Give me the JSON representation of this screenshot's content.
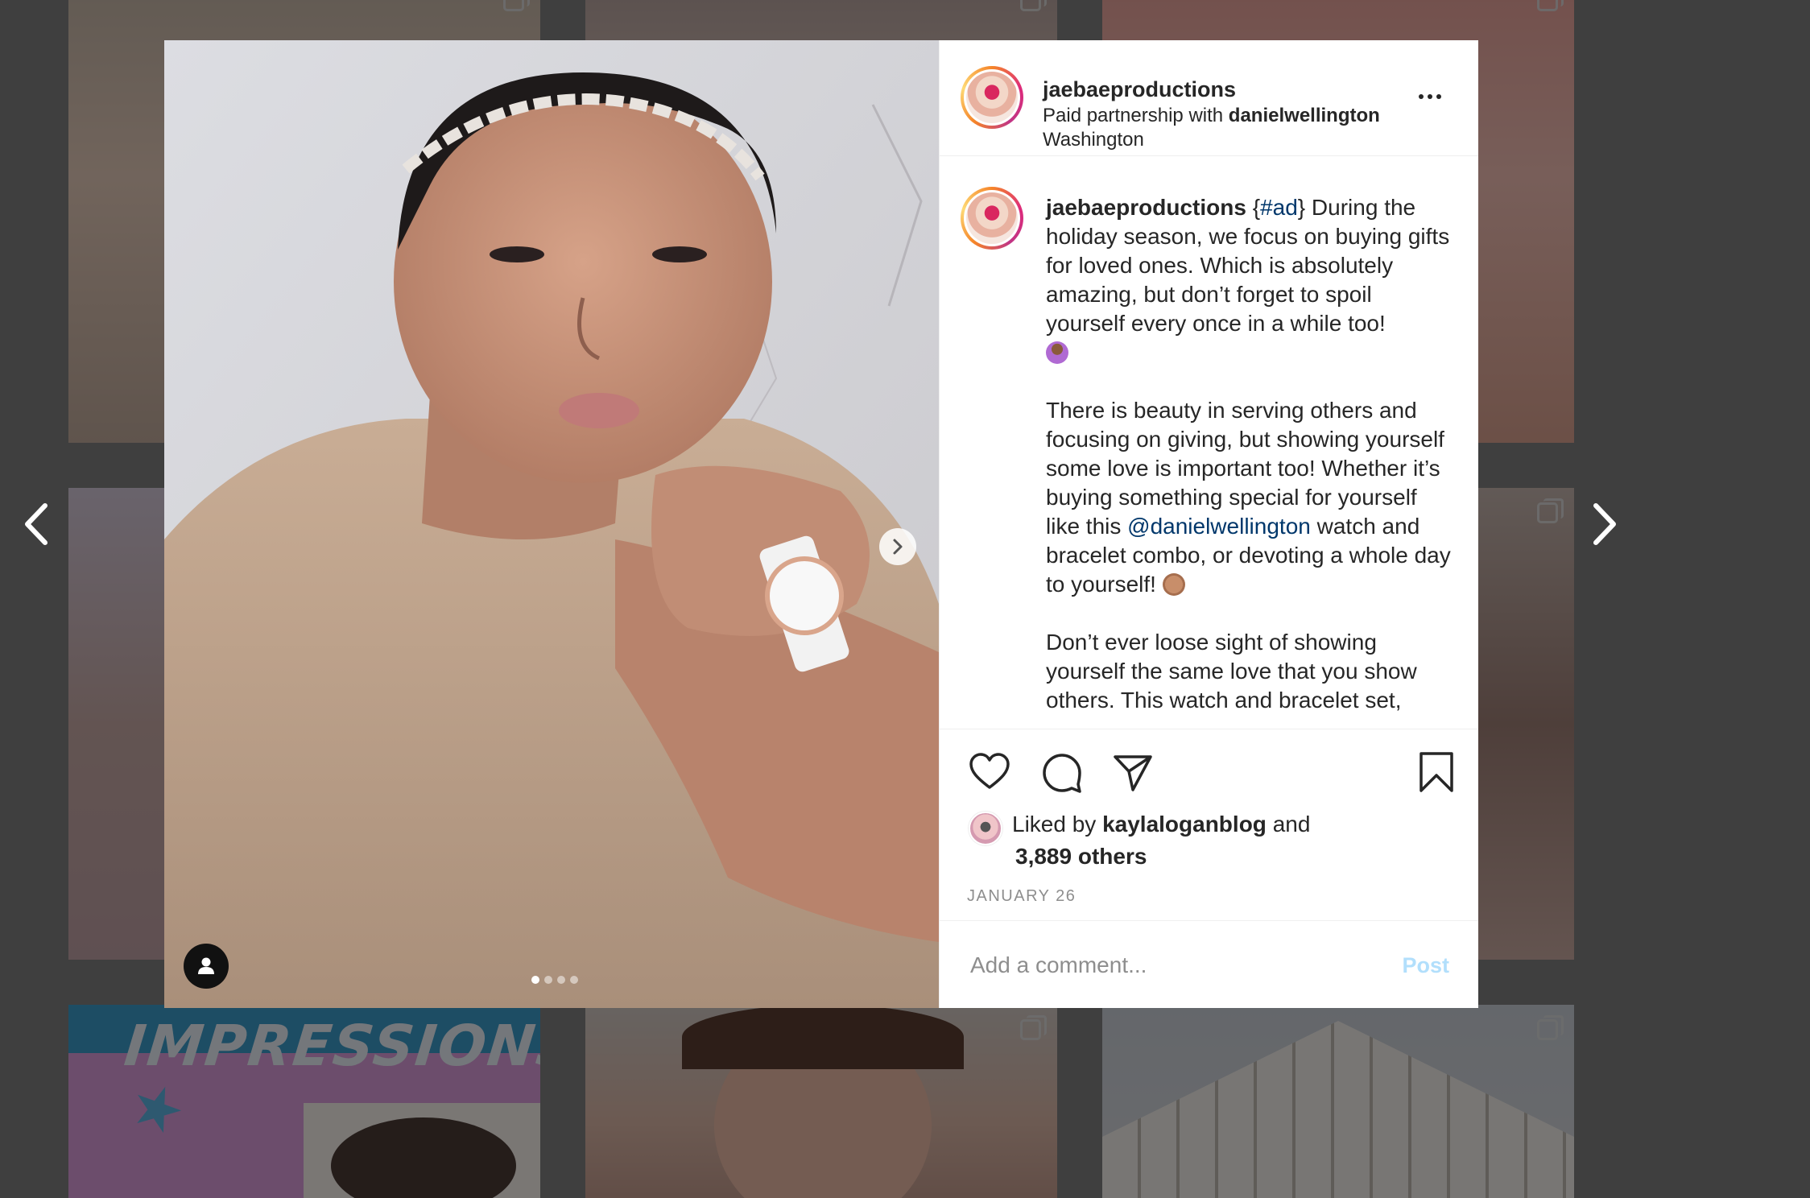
{
  "post": {
    "username": "jaebaeproductions",
    "partnership_prefix": "Paid partnership with",
    "partner": "danielwellington",
    "location": "Washington"
  },
  "caption": {
    "username": "jaebaeproductions",
    "p1_pre": "{",
    "p1_hashtag": "#ad",
    "p1_text": "} During the holiday season, we focus on buying gifts for loved ones. Which is absolutely amazing, but don’t forget to spoil yourself every once in a while too!",
    "p2_text": "There is beauty in serving others and focusing on giving, but showing yourself some love is important too! Whether it’s buying something special for yourself like this",
    "p2_mention": "@danielwellington",
    "p2_text_after": "watch and bracelet combo, or devoting a whole day to yourself!",
    "p3_text": "Don’t ever loose sight of showing yourself the same love that you show others. This watch and bracelet set,"
  },
  "likes": {
    "prefix": "Liked by",
    "user": "kaylaloganblog",
    "connector": "and",
    "others": "3,889 others"
  },
  "date": "JANUARY 26",
  "comment": {
    "placeholder": "Add a comment...",
    "post_label": "Post"
  },
  "colors": {
    "link": "#00376b",
    "post_button": "#b2dffc",
    "text": "#262626",
    "muted": "#8e8e8e"
  },
  "icons": [
    "chevron-left-icon",
    "chevron-right-icon",
    "more-icon",
    "heart-icon",
    "comment-icon",
    "share-icon",
    "bookmark-icon",
    "user-tag-icon"
  ]
}
